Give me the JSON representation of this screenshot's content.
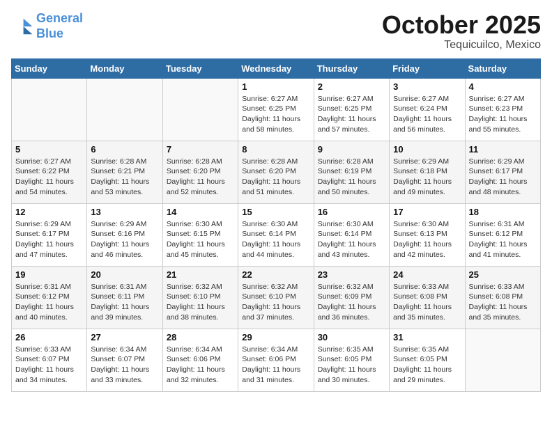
{
  "header": {
    "logo_line1": "General",
    "logo_line2": "Blue",
    "month": "October 2025",
    "location": "Tequicuilco, Mexico"
  },
  "weekdays": [
    "Sunday",
    "Monday",
    "Tuesday",
    "Wednesday",
    "Thursday",
    "Friday",
    "Saturday"
  ],
  "weeks": [
    [
      {
        "day": "",
        "info": ""
      },
      {
        "day": "",
        "info": ""
      },
      {
        "day": "",
        "info": ""
      },
      {
        "day": "1",
        "info": "Sunrise: 6:27 AM\nSunset: 6:25 PM\nDaylight: 11 hours\nand 58 minutes."
      },
      {
        "day": "2",
        "info": "Sunrise: 6:27 AM\nSunset: 6:25 PM\nDaylight: 11 hours\nand 57 minutes."
      },
      {
        "day": "3",
        "info": "Sunrise: 6:27 AM\nSunset: 6:24 PM\nDaylight: 11 hours\nand 56 minutes."
      },
      {
        "day": "4",
        "info": "Sunrise: 6:27 AM\nSunset: 6:23 PM\nDaylight: 11 hours\nand 55 minutes."
      }
    ],
    [
      {
        "day": "5",
        "info": "Sunrise: 6:27 AM\nSunset: 6:22 PM\nDaylight: 11 hours\nand 54 minutes."
      },
      {
        "day": "6",
        "info": "Sunrise: 6:28 AM\nSunset: 6:21 PM\nDaylight: 11 hours\nand 53 minutes."
      },
      {
        "day": "7",
        "info": "Sunrise: 6:28 AM\nSunset: 6:20 PM\nDaylight: 11 hours\nand 52 minutes."
      },
      {
        "day": "8",
        "info": "Sunrise: 6:28 AM\nSunset: 6:20 PM\nDaylight: 11 hours\nand 51 minutes."
      },
      {
        "day": "9",
        "info": "Sunrise: 6:28 AM\nSunset: 6:19 PM\nDaylight: 11 hours\nand 50 minutes."
      },
      {
        "day": "10",
        "info": "Sunrise: 6:29 AM\nSunset: 6:18 PM\nDaylight: 11 hours\nand 49 minutes."
      },
      {
        "day": "11",
        "info": "Sunrise: 6:29 AM\nSunset: 6:17 PM\nDaylight: 11 hours\nand 48 minutes."
      }
    ],
    [
      {
        "day": "12",
        "info": "Sunrise: 6:29 AM\nSunset: 6:17 PM\nDaylight: 11 hours\nand 47 minutes."
      },
      {
        "day": "13",
        "info": "Sunrise: 6:29 AM\nSunset: 6:16 PM\nDaylight: 11 hours\nand 46 minutes."
      },
      {
        "day": "14",
        "info": "Sunrise: 6:30 AM\nSunset: 6:15 PM\nDaylight: 11 hours\nand 45 minutes."
      },
      {
        "day": "15",
        "info": "Sunrise: 6:30 AM\nSunset: 6:14 PM\nDaylight: 11 hours\nand 44 minutes."
      },
      {
        "day": "16",
        "info": "Sunrise: 6:30 AM\nSunset: 6:14 PM\nDaylight: 11 hours\nand 43 minutes."
      },
      {
        "day": "17",
        "info": "Sunrise: 6:30 AM\nSunset: 6:13 PM\nDaylight: 11 hours\nand 42 minutes."
      },
      {
        "day": "18",
        "info": "Sunrise: 6:31 AM\nSunset: 6:12 PM\nDaylight: 11 hours\nand 41 minutes."
      }
    ],
    [
      {
        "day": "19",
        "info": "Sunrise: 6:31 AM\nSunset: 6:12 PM\nDaylight: 11 hours\nand 40 minutes."
      },
      {
        "day": "20",
        "info": "Sunrise: 6:31 AM\nSunset: 6:11 PM\nDaylight: 11 hours\nand 39 minutes."
      },
      {
        "day": "21",
        "info": "Sunrise: 6:32 AM\nSunset: 6:10 PM\nDaylight: 11 hours\nand 38 minutes."
      },
      {
        "day": "22",
        "info": "Sunrise: 6:32 AM\nSunset: 6:10 PM\nDaylight: 11 hours\nand 37 minutes."
      },
      {
        "day": "23",
        "info": "Sunrise: 6:32 AM\nSunset: 6:09 PM\nDaylight: 11 hours\nand 36 minutes."
      },
      {
        "day": "24",
        "info": "Sunrise: 6:33 AM\nSunset: 6:08 PM\nDaylight: 11 hours\nand 35 minutes."
      },
      {
        "day": "25",
        "info": "Sunrise: 6:33 AM\nSunset: 6:08 PM\nDaylight: 11 hours\nand 35 minutes."
      }
    ],
    [
      {
        "day": "26",
        "info": "Sunrise: 6:33 AM\nSunset: 6:07 PM\nDaylight: 11 hours\nand 34 minutes."
      },
      {
        "day": "27",
        "info": "Sunrise: 6:34 AM\nSunset: 6:07 PM\nDaylight: 11 hours\nand 33 minutes."
      },
      {
        "day": "28",
        "info": "Sunrise: 6:34 AM\nSunset: 6:06 PM\nDaylight: 11 hours\nand 32 minutes."
      },
      {
        "day": "29",
        "info": "Sunrise: 6:34 AM\nSunset: 6:06 PM\nDaylight: 11 hours\nand 31 minutes."
      },
      {
        "day": "30",
        "info": "Sunrise: 6:35 AM\nSunset: 6:05 PM\nDaylight: 11 hours\nand 30 minutes."
      },
      {
        "day": "31",
        "info": "Sunrise: 6:35 AM\nSunset: 6:05 PM\nDaylight: 11 hours\nand 29 minutes."
      },
      {
        "day": "",
        "info": ""
      }
    ]
  ]
}
